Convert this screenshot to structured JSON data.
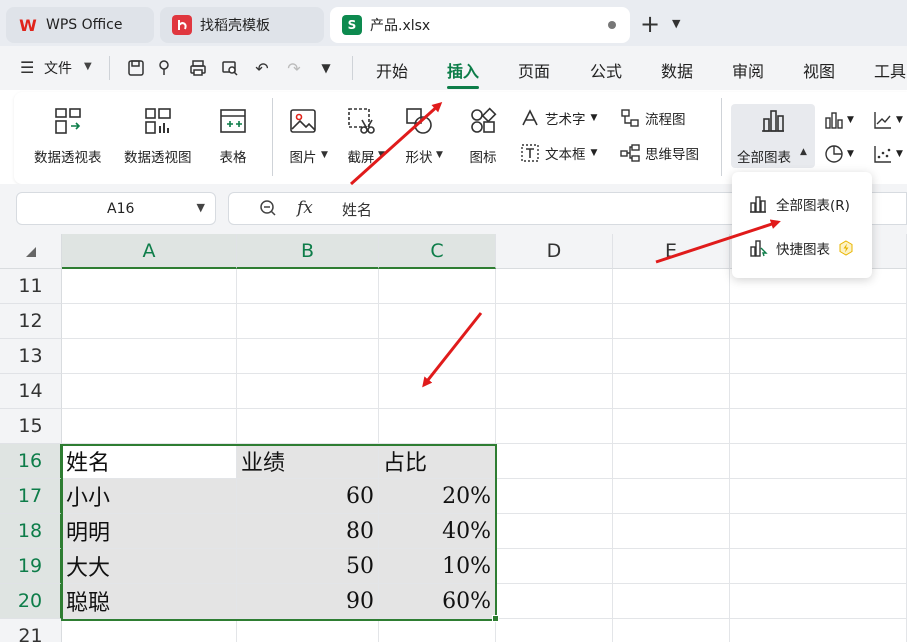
{
  "tabs": [
    {
      "label": "WPS Office",
      "logo": "W"
    },
    {
      "label": "找稻壳模板",
      "logo": "d"
    },
    {
      "label": "产品.xlsx",
      "logo": "S"
    }
  ],
  "menu": {
    "file_label": "文件",
    "items": [
      "开始",
      "插入",
      "页面",
      "公式",
      "数据",
      "审阅",
      "视图",
      "工具"
    ],
    "active": "插入"
  },
  "ribbon": {
    "pivot_table": "数据透视表",
    "pivot_chart": "数据透视图",
    "table": "表格",
    "picture": "图片",
    "screenshot": "截屏",
    "shape": "形状",
    "icon": "图标",
    "art_text": "艺术字",
    "text_box": "文本框",
    "flowchart": "流程图",
    "mindmap": "思维导图",
    "all_charts": "全部图表"
  },
  "formula_bar": {
    "cell_ref": "A16",
    "fx": "fx",
    "value": "姓名"
  },
  "dropdown": {
    "all_charts_item": "全部图表(R)",
    "quick_chart_item": "快捷图表"
  },
  "grid": {
    "columns": [
      "A",
      "B",
      "C",
      "D",
      "E",
      "F"
    ],
    "rows": [
      "11",
      "12",
      "13",
      "14",
      "15",
      "16",
      "17",
      "18",
      "19",
      "20",
      "21"
    ],
    "table": [
      [
        "姓名",
        "业绩",
        "占比"
      ],
      [
        "小小",
        "60",
        "20%"
      ],
      [
        "明明",
        "80",
        "40%"
      ],
      [
        "大大",
        "50",
        "10%"
      ],
      [
        "聪聪",
        "90",
        "60%"
      ]
    ]
  },
  "colors": {
    "accent": "#0d7d49",
    "selection": "#2e7d32",
    "annotation_arrow": "#e01b1b"
  }
}
